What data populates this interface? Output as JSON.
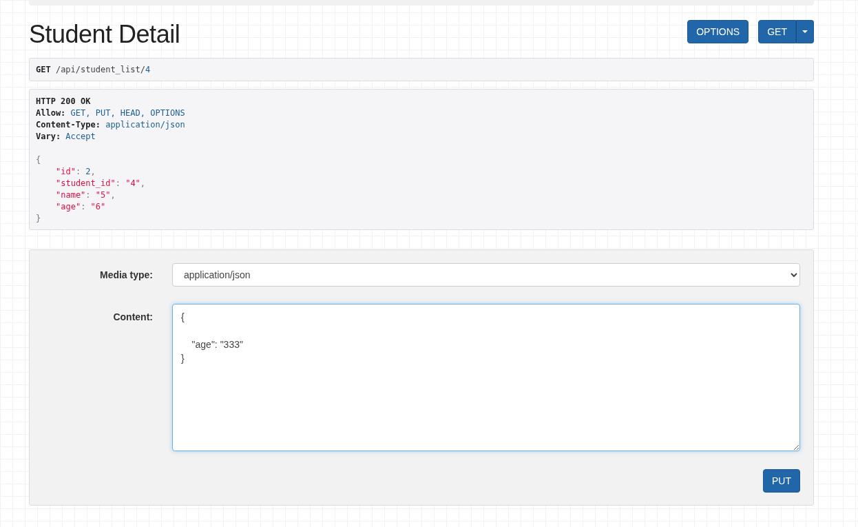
{
  "title": "Student Detail",
  "actions": [
    {
      "kind": "button",
      "label": "OPTIONS"
    },
    {
      "kind": "split",
      "label": "GET"
    }
  ],
  "request": {
    "method": "GET",
    "path": "/api/student_list/",
    "path_end": "4"
  },
  "response": {
    "status": "HTTP 200 OK",
    "headers": [
      {
        "name": "Allow:",
        "value": "GET, PUT, HEAD, OPTIONS"
      },
      {
        "name": "Content-Type:",
        "value": "application/json"
      },
      {
        "name": "Vary:",
        "value": "Accept"
      }
    ],
    "open": "{",
    "fields": [
      [
        {
          "text": "\"id\"",
          "kind": "string"
        },
        {
          "text": ": ",
          "kind": "punct"
        },
        {
          "text": "2",
          "kind": "number"
        },
        {
          "text": ",",
          "kind": "punct"
        }
      ],
      [
        {
          "text": "\"student_id\"",
          "kind": "string"
        },
        {
          "text": ": ",
          "kind": "punct"
        },
        {
          "text": "\"4\"",
          "kind": "string"
        },
        {
          "text": ",",
          "kind": "punct"
        }
      ],
      [
        {
          "text": "\"name\"",
          "kind": "string"
        },
        {
          "text": ": ",
          "kind": "punct"
        },
        {
          "text": "\"5\"",
          "kind": "string"
        },
        {
          "text": ",",
          "kind": "punct"
        }
      ],
      [
        {
          "text": "\"age\"",
          "kind": "string"
        },
        {
          "text": ": ",
          "kind": "punct"
        },
        {
          "text": "\"6\"",
          "kind": "string"
        }
      ]
    ],
    "close": "}"
  },
  "form": {
    "media_label": "Media type:",
    "media_value": "application/json",
    "content_label": "Content:",
    "content_value": "{\n\n    \"age\": \"333\"\n}",
    "submit": "PUT"
  }
}
